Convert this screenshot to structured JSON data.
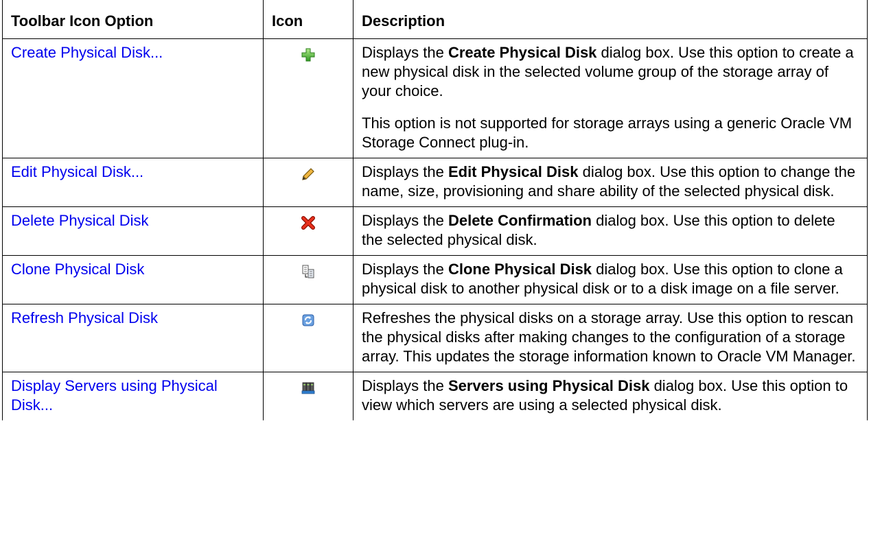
{
  "table": {
    "headers": [
      "Toolbar Icon Option",
      "Icon",
      "Description"
    ],
    "rows": [
      {
        "option": "Create Physical Disk...",
        "icon": "plus-icon",
        "desc": [
          {
            "a": "Displays the ",
            "b": "Create Physical Disk",
            "c": " dialog box. Use this option to create a new physical disk in the selected volume group of the storage array of your choice."
          },
          {
            "a": "This option is not supported for storage arrays using a generic Oracle VM Storage Connect plug-in.",
            "b": "",
            "c": ""
          }
        ]
      },
      {
        "option": "Edit Physical Disk...",
        "icon": "pencil-icon",
        "desc": [
          {
            "a": "Displays the ",
            "b": "Edit Physical Disk",
            "c": " dialog box. Use this option to change the name, size, provisioning and share ability of the selected physical disk."
          }
        ]
      },
      {
        "option": "Delete Physical Disk",
        "icon": "delete-x-icon",
        "desc": [
          {
            "a": "Displays the ",
            "b": "Delete Confirmation",
            "c": " dialog box. Use this option to delete the selected physical disk."
          }
        ]
      },
      {
        "option": "Clone Physical Disk",
        "icon": "clone-icon",
        "desc": [
          {
            "a": "Displays the ",
            "b": "Clone Physical Disk",
            "c": " dialog box. Use this option to clone a physical disk to another physical disk or to a disk image on a file server."
          }
        ]
      },
      {
        "option": "Refresh Physical Disk",
        "icon": "refresh-icon",
        "desc": [
          {
            "a": "Refreshes the physical disks on a storage array. Use this option to rescan the physical disks after making changes to the configuration of a storage array. This updates the storage information known to Oracle VM Manager.",
            "b": "",
            "c": ""
          }
        ]
      },
      {
        "option": "Display Servers using Physical Disk...",
        "icon": "servers-icon",
        "desc": [
          {
            "a": "Displays the ",
            "b": "Servers using Physical Disk",
            "c": " dialog box. Use this option to view which servers are using a selected physical disk."
          }
        ]
      }
    ]
  }
}
